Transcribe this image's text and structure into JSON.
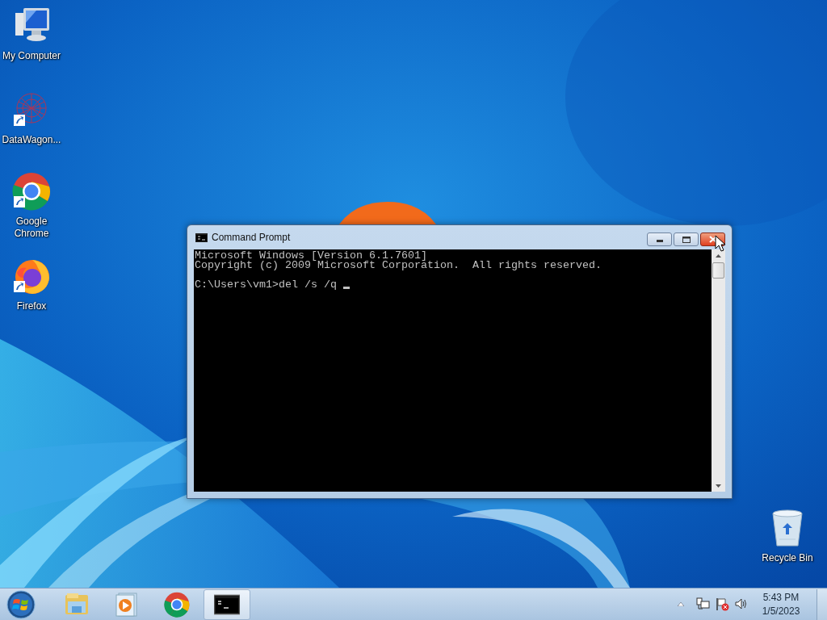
{
  "desktop_icons": [
    {
      "label": "My Computer",
      "kind": "computer",
      "shortcut": false
    },
    {
      "label": "DataWagon...",
      "kind": "datawagon",
      "shortcut": true
    },
    {
      "label": "Google Chrome",
      "kind": "chrome",
      "shortcut": true
    },
    {
      "label": "Firefox",
      "kind": "firefox",
      "shortcut": true
    },
    {
      "label": "Recycle Bin",
      "kind": "recycle",
      "shortcut": false
    }
  ],
  "window": {
    "title": "Command Prompt",
    "close_hovered": true,
    "output": [
      "Microsoft Windows [Version 6.1.7601]",
      "Copyright (c) 2009 Microsoft Corporation.  All rights reserved."
    ],
    "prompt": "C:\\Users\\vm1>del /s /q"
  },
  "taskbar": {
    "items": [
      {
        "kind": "explorer",
        "active": false
      },
      {
        "kind": "media",
        "active": false
      },
      {
        "kind": "chrome",
        "active": false
      },
      {
        "kind": "cmd",
        "active": true
      }
    ],
    "tray": [
      {
        "kind": "network"
      },
      {
        "kind": "flag"
      },
      {
        "kind": "volume"
      }
    ],
    "time": "5:43 PM",
    "date": "1/5/2023"
  }
}
